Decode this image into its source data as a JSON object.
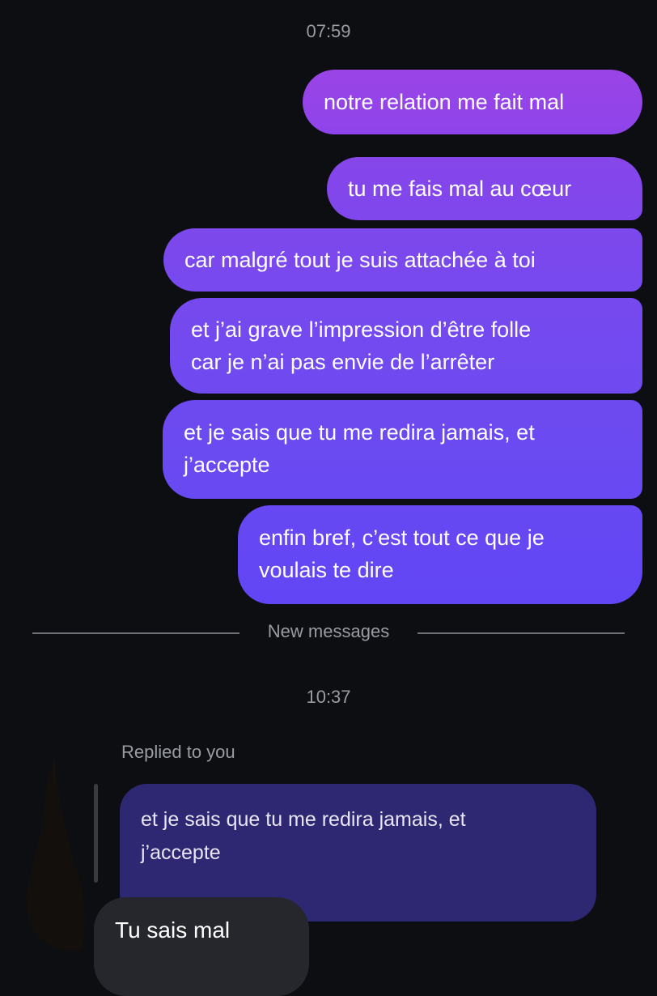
{
  "conversation": {
    "timestamp_1": "07:59",
    "sent_messages": [
      "notre relation me fait mal",
      "tu me fais mal au cœur",
      "car malgré tout je suis attachée à toi",
      "et j’ai grave l’impression d’être folle\ncar je n’ai pas envie de l’arrêter",
      "et je sais que tu me redira jamais, et\nj’accepte",
      "enfin bref, c’est tout ce que je\nvoulais te dire"
    ],
    "divider_label": "New messages",
    "timestamp_2": "10:37",
    "reply": {
      "label": "Replied to you",
      "quoted_text": "et je sais que tu me redira jamais, et\nj’accepte",
      "message": "Tu sais mal"
    }
  },
  "colors": {
    "background": "#0c0e12",
    "sent_top": "#9a44e6",
    "sent_bottom": "#6246f5",
    "quoted_bubble": "#2e2873",
    "received_bubble": "#25272c"
  }
}
